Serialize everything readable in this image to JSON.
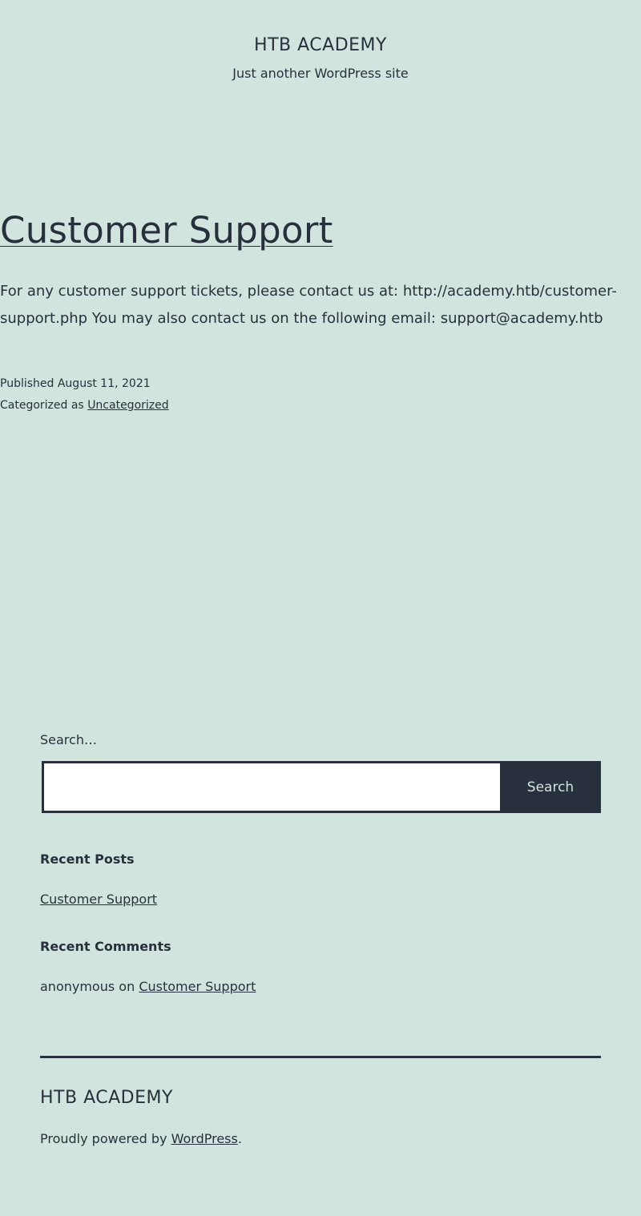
{
  "site": {
    "title": "HTB ACADEMY",
    "description": "Just another WordPress site"
  },
  "post": {
    "title": "Customer Support",
    "content": "For any customer support tickets, please contact us at: http://academy.htb/customer-support.php You may also contact us on the following email: support@academy.htb",
    "published_label": "Published",
    "published_date": "August 11, 2021",
    "categorized_label": "Categorized as",
    "category": "Uncategorized"
  },
  "search": {
    "label": "Search…",
    "value": "",
    "button_label": "Search"
  },
  "recent_posts": {
    "title": "Recent Posts",
    "items": [
      "Customer Support"
    ]
  },
  "recent_comments": {
    "title": "Recent Comments",
    "items": [
      {
        "author": "anonymous",
        "on": "on",
        "post": "Customer Support"
      }
    ]
  },
  "footer": {
    "title": "HTB ACADEMY",
    "powered_prefix": "Proudly powered by",
    "powered_link": "WordPress",
    "powered_suffix": "."
  },
  "colors": {
    "background": "#d1e4dd",
    "text": "#28303d",
    "button_bg": "#28303d"
  }
}
